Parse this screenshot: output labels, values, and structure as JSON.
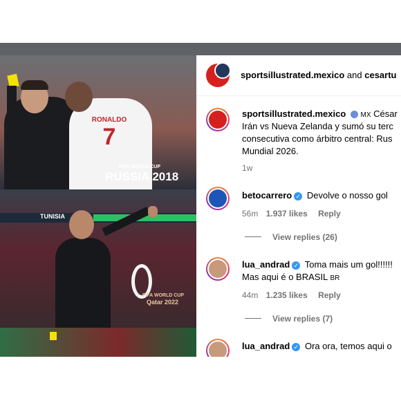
{
  "header": {
    "account": "sportsillustrated.mexico",
    "and": "and",
    "coauthor": "cesartu"
  },
  "photo": {
    "top_text": "FIFA WORLD CUP",
    "top_brand": "RUSSIA 2018",
    "jersey_name": "RONALDO",
    "jersey_number": "7",
    "board_text": "TUNISIA",
    "mid_text": "FIFA WORLD CUP",
    "mid_brand": "Qatar 2022"
  },
  "caption": {
    "user": "sportsillustrated.mexico",
    "flag": "MX",
    "line1": "César",
    "line2": "Irán vs Nueva Zelanda y sumó su terc",
    "line3": "consecutiva como árbitro central: Rus",
    "line4": "Mundial 2026.",
    "time": "1w"
  },
  "comments": [
    {
      "user": "betocarrero",
      "text": "Devolve o nosso gol",
      "time": "56m",
      "likes": "1.937 likes",
      "reply": "Reply",
      "view": "View replies (26)"
    },
    {
      "user": "lua_andrad",
      "text": "Toma mais um gol!!!!!!",
      "text2": "Mas aqui é o BRASIL",
      "flag": "BR",
      "time": "44m",
      "likes": "1.235 likes",
      "reply": "Reply",
      "view": "View replies (7)"
    },
    {
      "user": "lua_andrad",
      "text": "Ora ora, temos aqui o"
    }
  ],
  "colors": {
    "verified": "#3897f0",
    "secondary": "#737373",
    "si_red": "#d6201d"
  }
}
